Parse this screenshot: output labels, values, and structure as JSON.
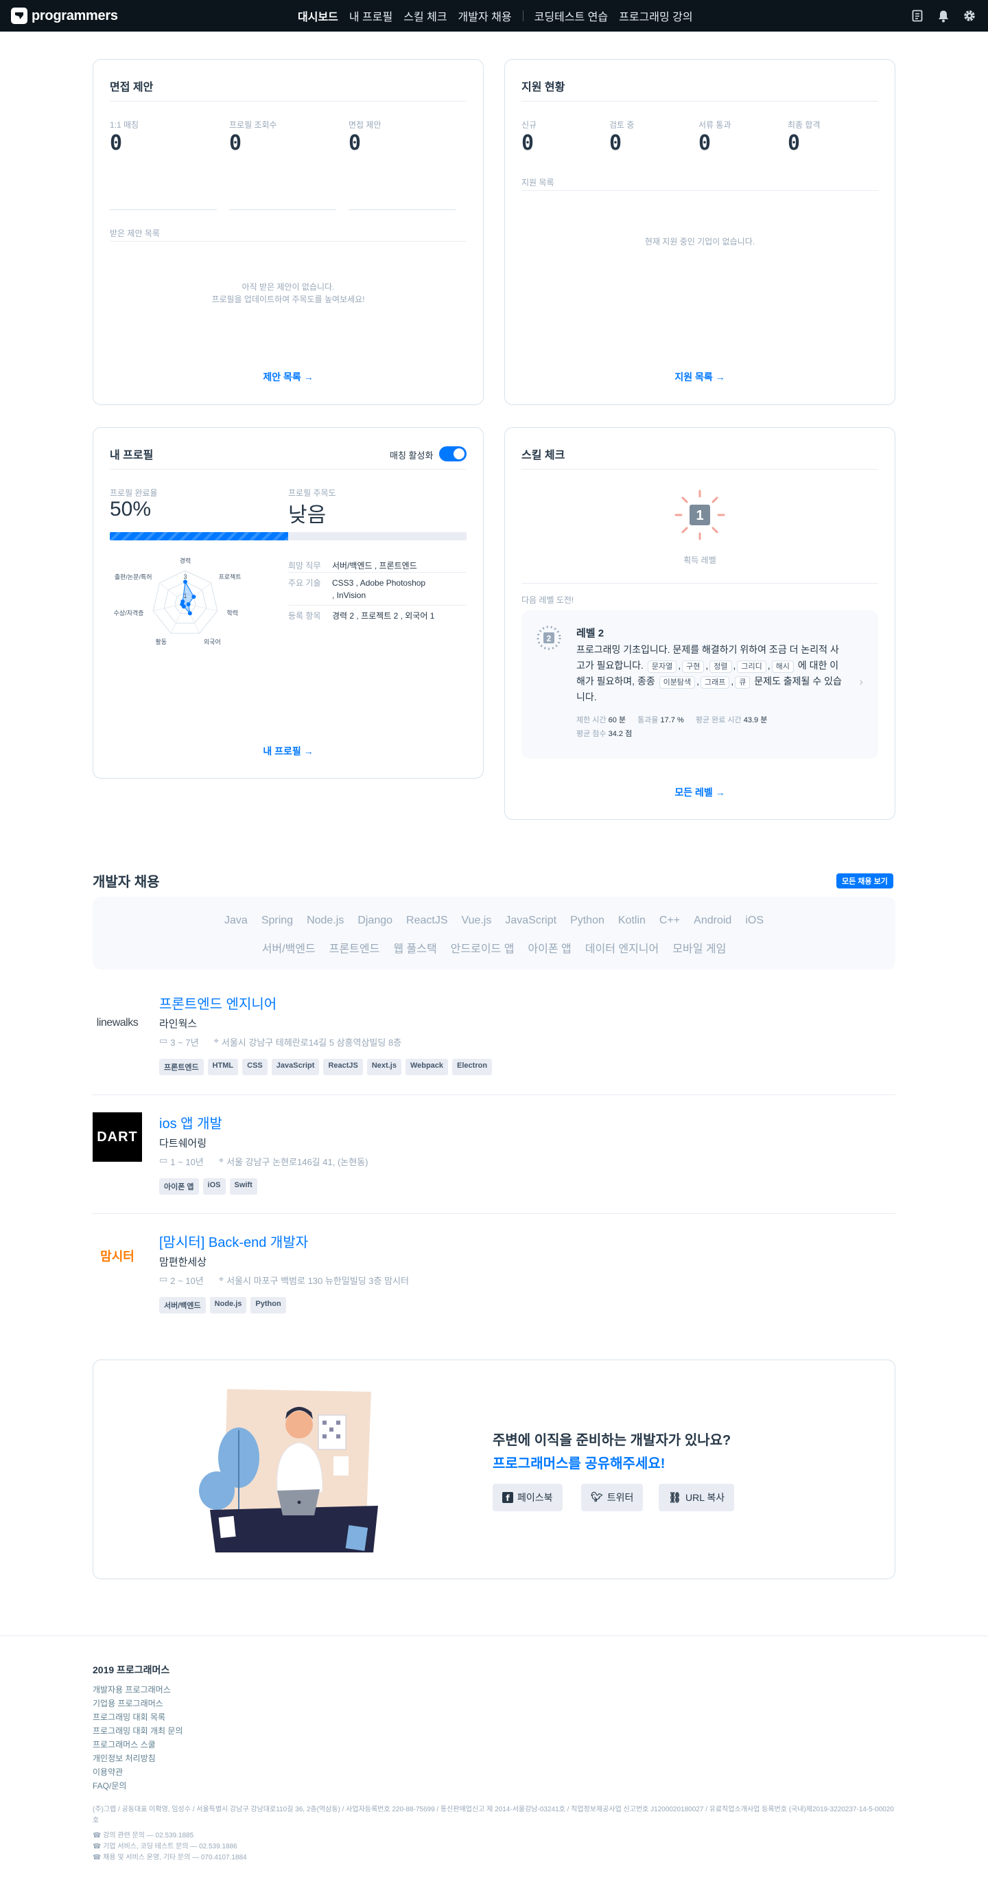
{
  "nav": {
    "logo": "programmers",
    "menu": [
      "대시보드",
      "내 프로필",
      "스킬 체크",
      "개발자 채용",
      "코딩테스트 연습",
      "프로그래밍 강의"
    ],
    "active_index": 0,
    "icons": [
      "resume-icon",
      "bell-icon",
      "gear-icon"
    ]
  },
  "interview": {
    "title": "면접 제안",
    "stats": [
      {
        "label": "1:1 매칭",
        "value": "0"
      },
      {
        "label": "프로필 조회수",
        "value": "0"
      },
      {
        "label": "면접 제안",
        "value": "0"
      }
    ],
    "list_label": "받은 제안 목록",
    "empty_line1": "아직 받은 제안이 없습니다.",
    "empty_line2": "프로필을 업데이트하여 주목도를 높여보세요!",
    "link": "제안 목록 →"
  },
  "applications": {
    "title": "지원 현황",
    "stats": [
      {
        "label": "신규",
        "value": "0"
      },
      {
        "label": "검토 중",
        "value": "0"
      },
      {
        "label": "서류 통과",
        "value": "0"
      },
      {
        "label": "최종 합격",
        "value": "0"
      }
    ],
    "list_label": "지원 목록",
    "empty": "현재 지원 중인 기업이 없습니다.",
    "link": "지원 목록 →"
  },
  "profile": {
    "title": "내 프로필",
    "matching_label": "매칭 활성화",
    "matching_on": true,
    "completion_label": "프로필 완료율",
    "completion_value": "50%",
    "completion_fraction": 0.5,
    "attention_label": "프로필 주목도",
    "attention_value": "낮음",
    "radar_labels": [
      "경력",
      "프로젝트",
      "학력",
      "외국어",
      "활동",
      "수상/자격증",
      "출판/논문/특허"
    ],
    "radar_center_values": [
      "3",
      "1"
    ],
    "rows": [
      {
        "key": "희망 직무",
        "value": "서버/백엔드 , 프론트엔드"
      },
      {
        "key": "주요 기술",
        "value": "CSS3 , Adobe Photoshop , InVision"
      },
      {
        "key": "등록 항목",
        "value": "경력 2 , 프로젝트 2 , 외국어 1"
      }
    ],
    "link": "내 프로필 →"
  },
  "skill": {
    "title": "스킬 체크",
    "level_badge": "1",
    "level_caption": "획득 레벨",
    "next_label": "다음 레벨 도전!",
    "next_badge": "2",
    "next_title": "레벨 2",
    "desc_a": "프로그래밍 기초입니다. 문제를 해결하기 위하여 조금 더 논리적 사고가 필요합니다.",
    "chips": [
      "문자열",
      "구현",
      "정렬",
      "그리디",
      "해시"
    ],
    "desc_b": "에 대한 이해가 필요하며, 종종",
    "chips2": [
      "이분탐색",
      "그래프",
      "큐"
    ],
    "desc_c": "문제도 출제될 수 있습니다.",
    "meta": [
      {
        "k": "제한 시간",
        "v": "60 분"
      },
      {
        "k": "통과율",
        "v": "17.7 %"
      },
      {
        "k": "평균 완료 시간",
        "v": "43.9 분"
      },
      {
        "k": "평균 점수",
        "v": "34.2 점"
      }
    ],
    "link": "모든 레벨 →"
  },
  "jobs": {
    "title": "개발자 채용",
    "all_button": "모든 채용 보기",
    "filters_row1": [
      "Java",
      "Spring",
      "Node.js",
      "Django",
      "ReactJS",
      "Vue.js",
      "JavaScript",
      "Python",
      "Kotlin",
      "C++",
      "Android",
      "iOS"
    ],
    "filters_row2": [
      "서버/백엔드",
      "프론트엔드",
      "웹 풀스택",
      "안드로이드 앱",
      "아이폰 앱",
      "데이터 엔지니어",
      "모바일 게임"
    ],
    "list": [
      {
        "logo": "linewalks",
        "title": "프론트엔드 엔지니어",
        "company": "라인웍스",
        "career": "3 ~ 7년",
        "location": "서울시 강남구 테헤란로14길 5 삼흥역삼빌딩 8층",
        "tags": [
          "프론트엔드",
          "HTML",
          "CSS",
          "JavaScript",
          "ReactJS",
          "Next.js",
          "Webpack",
          "Electron"
        ]
      },
      {
        "logo": "DART",
        "title": "ios 앱 개발",
        "company": "다트쉐어링",
        "career": "1 ~ 10년",
        "location": "서울 강남구 논현로146길 41, (논현동)",
        "tags": [
          "아이폰 앱",
          "iOS",
          "Swift"
        ]
      },
      {
        "logo": "맘시터",
        "title": "[맘시터] Back-end 개발자",
        "company": "맘편한세상",
        "career": "2 ~ 10년",
        "location": "서울시 마포구 백범로 130 뉴한밀빌딩 3층 맘시터",
        "tags": [
          "서버/백엔드",
          "Node.js",
          "Python"
        ]
      }
    ]
  },
  "share": {
    "question": "주변에 이직을 준비하는 개발자가 있나요?",
    "cta": "프로그래머스를 공유해주세요!",
    "buttons": [
      "페이스북",
      "트위터",
      "URL 복사"
    ]
  },
  "footer": {
    "title": "2019 프로그래머스",
    "links": [
      "개발자용 프로그래머스",
      "기업용 프로그래머스",
      "프로그래밍 대회 목록",
      "프로그래밍 대회 개최 문의",
      "프로그래머스 스쿨",
      "개인정보 처리방침",
      "이용약관",
      "FAQ/문의"
    ],
    "company_info": "(주)그렙 / 공동대표 이확영, 임성수 / 서울특별시 강남구 강남대로110길 36, 2층(역삼동) / 사업자등록번호 220-88-75699 / 통신판매업신고 제 2014-서울강남-03241호 / 직업정보제공사업 신고번호 J1200020180027 / 유료직업소개사업 등록번호 (국내)제2019-3220237-14-5-00020호",
    "contacts": [
      "☎ 강의 관련 문의 — 02.539.1885",
      "☎ 기업 서비스, 코딩 테스트 문의 — 02.539.1886",
      "☎ 채용 및 서비스 운영, 기타 문의 — 070.4107.1884"
    ]
  }
}
